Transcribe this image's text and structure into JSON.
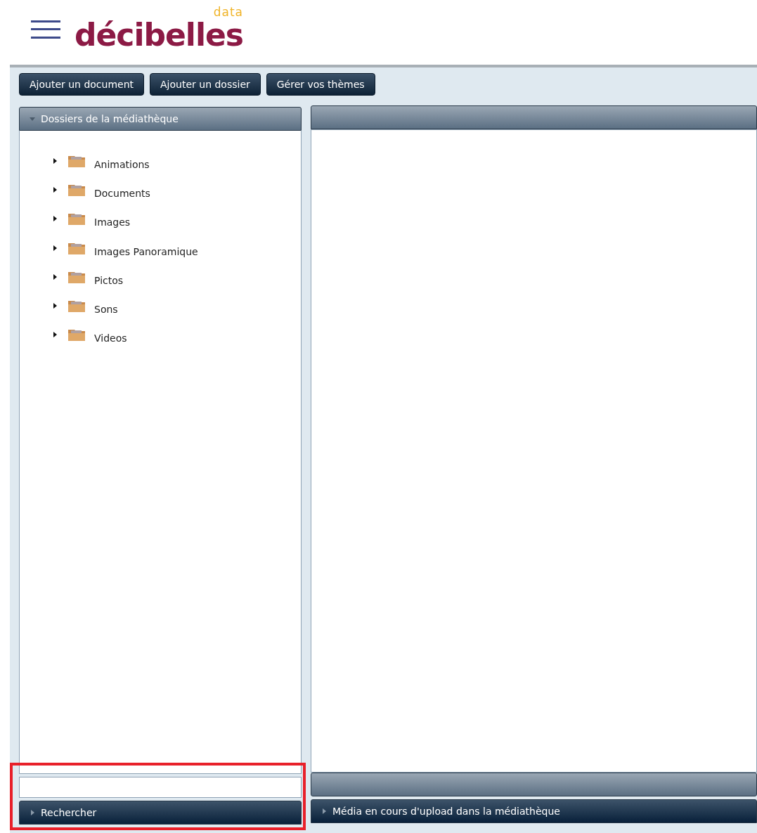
{
  "logo": {
    "name": "décibelles",
    "tag": "data"
  },
  "toolbar": [
    "Ajouter un document",
    "Ajouter un dossier",
    "Gérer vos thèmes"
  ],
  "folders_panel": {
    "title": "Dossiers de la médiathèque",
    "expanded": true,
    "items": [
      {
        "label": "Animations",
        "expanded": false
      },
      {
        "label": "Documents",
        "expanded": false
      },
      {
        "label": "Images",
        "expanded": false
      },
      {
        "label": "Images Panoramique",
        "expanded": false
      },
      {
        "label": "Pictos",
        "expanded": false
      },
      {
        "label": "Sons",
        "expanded": false
      },
      {
        "label": "Videos",
        "expanded": false
      }
    ]
  },
  "search_panel": {
    "title": "Rechercher",
    "expanded": false
  },
  "upload_panel": {
    "title": "Média en cours d'upload dans la médiathèque",
    "expanded": false
  }
}
